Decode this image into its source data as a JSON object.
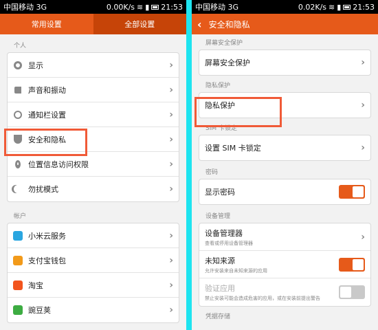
{
  "left": {
    "status": {
      "carrier": "中国移动 3G",
      "speed": "0.00K/s",
      "time": "21:53"
    },
    "tabs": [
      {
        "label": "常用设置"
      },
      {
        "label": "全部设置"
      }
    ],
    "sections": [
      {
        "title": "个人",
        "items": [
          {
            "label": "显示",
            "icon": "display-icon"
          },
          {
            "label": "声音和振动",
            "icon": "sound-icon"
          },
          {
            "label": "通知栏设置",
            "icon": "notification-icon"
          },
          {
            "label": "安全和隐私",
            "icon": "shield-icon"
          },
          {
            "label": "位置信息访问权限",
            "icon": "location-icon"
          },
          {
            "label": "勿扰模式",
            "icon": "moon-icon"
          }
        ]
      },
      {
        "title": "帐户",
        "items": [
          {
            "label": "小米云服务",
            "icon": "cloud-icon"
          },
          {
            "label": "支付宝钱包",
            "icon": "wallet-icon"
          },
          {
            "label": "淘宝",
            "icon": "taobao-icon"
          },
          {
            "label": "豌豆荚",
            "icon": "wandoujia-icon"
          }
        ]
      }
    ]
  },
  "right": {
    "status": {
      "carrier": "中国移动 3G",
      "speed": "0.02K/s",
      "time": "21:53"
    },
    "title": "安全和隐私",
    "sections": [
      {
        "title": "屏幕安全保护",
        "items": [
          {
            "label": "屏幕安全保护"
          }
        ]
      },
      {
        "title": "隐私保护",
        "items": [
          {
            "label": "隐私保护"
          }
        ]
      },
      {
        "title": "SIM 卡锁定",
        "items": [
          {
            "label": "设置 SIM 卡锁定"
          }
        ]
      },
      {
        "title": "密码",
        "items": [
          {
            "label": "显示密码",
            "toggle": true
          }
        ]
      },
      {
        "title": "设备管理",
        "items": [
          {
            "label": "设备管理器",
            "sub": "查看或停用设备管理器"
          },
          {
            "label": "未知来源",
            "sub": "允许安装来自未知来源的应用",
            "toggle": true
          },
          {
            "label": "验证应用",
            "sub": "禁止安装可能会造成危害的应用，或在安装前提出警告",
            "toggle": false
          }
        ]
      },
      {
        "title": "凭据存储"
      }
    ]
  },
  "colors": {
    "accent": "#e65a1a",
    "highlight": "#f05a37",
    "divider": "#1ee4f0"
  }
}
